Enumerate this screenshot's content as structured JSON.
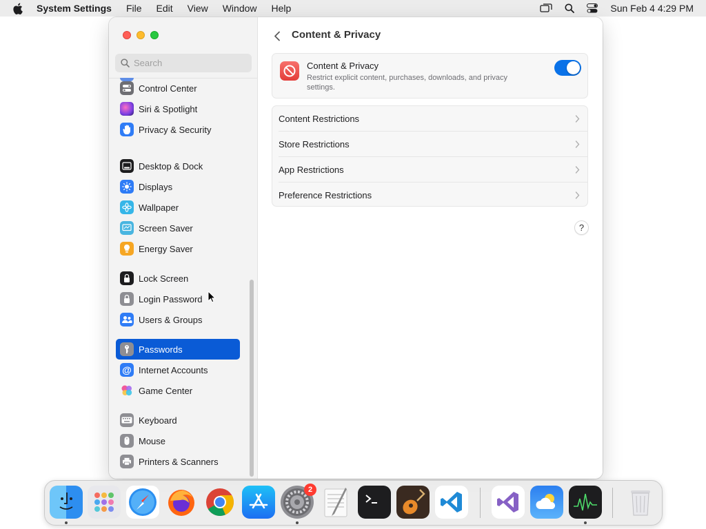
{
  "menubar": {
    "app_name": "System Settings",
    "menus": [
      "File",
      "Edit",
      "View",
      "Window",
      "Help"
    ],
    "datetime": "Sun Feb 4  4:29 PM"
  },
  "sidebar": {
    "search_placeholder": "Search",
    "items": [
      {
        "label": "Control Center",
        "icon": "control-center-icon",
        "color": "#6e6e73"
      },
      {
        "label": "Siri & Spotlight",
        "icon": "siri-icon",
        "color": "#a64ce0"
      },
      {
        "label": "Privacy & Security",
        "icon": "hand-icon",
        "color": "#2f7cf6"
      },
      {
        "label": "Desktop & Dock",
        "icon": "dock-icon",
        "color": "#1d1d1f"
      },
      {
        "label": "Displays",
        "icon": "sun-icon",
        "color": "#2f7cf6"
      },
      {
        "label": "Wallpaper",
        "icon": "flower-icon",
        "color": "#35b6e8"
      },
      {
        "label": "Screen Saver",
        "icon": "screen-saver-icon",
        "color": "#48b5e0"
      },
      {
        "label": "Energy Saver",
        "icon": "bulb-icon",
        "color": "#f6a623"
      },
      {
        "label": "Lock Screen",
        "icon": "lock-icon",
        "color": "#1d1d1f"
      },
      {
        "label": "Login Password",
        "icon": "lock-icon",
        "color": "#8e8e93"
      },
      {
        "label": "Users & Groups",
        "icon": "users-icon",
        "color": "#2f7cf6"
      },
      {
        "label": "Passwords",
        "icon": "key-icon",
        "color": "#8e8e93",
        "selected": true
      },
      {
        "label": "Internet Accounts",
        "icon": "at-icon",
        "color": "#2f7cf6"
      },
      {
        "label": "Game Center",
        "icon": "game-center-icon",
        "color": "#f05a9b"
      },
      {
        "label": "Keyboard",
        "icon": "keyboard-icon",
        "color": "#8e8e93"
      },
      {
        "label": "Mouse",
        "icon": "mouse-icon",
        "color": "#8e8e93"
      },
      {
        "label": "Printers & Scanners",
        "icon": "printer-icon",
        "color": "#8e8e93"
      }
    ]
  },
  "content": {
    "title": "Content & Privacy",
    "main_card": {
      "title": "Content & Privacy",
      "description": "Restrict explicit content, purchases, downloads, and privacy settings.",
      "toggle_on": true
    },
    "rows": [
      "Content Restrictions",
      "Store Restrictions",
      "App Restrictions",
      "Preference Restrictions"
    ],
    "help_label": "?"
  },
  "dock": {
    "apps": [
      "Finder",
      "Launchpad",
      "Safari",
      "Firefox",
      "Chrome",
      "App Store",
      "System Settings",
      "TextEdit",
      "Terminal",
      "GarageBand",
      "Visual Studio Code",
      "Visual Studio",
      "Weather",
      "Activity Monitor",
      "Trash"
    ],
    "badge": "2"
  }
}
